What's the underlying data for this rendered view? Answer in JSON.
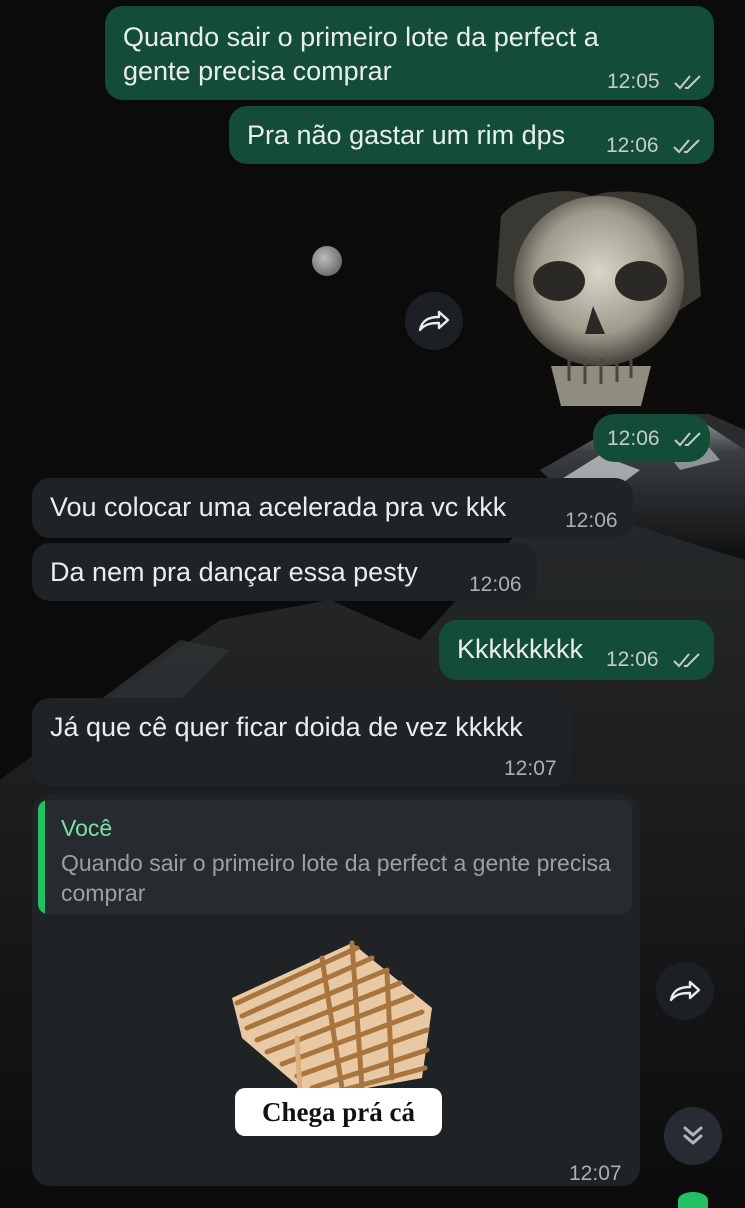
{
  "colors": {
    "outgoing_bubble": "#144d37",
    "incoming_bubble": "#1f2326",
    "read_ticks": "#c4cbd0",
    "quote_accent": "#21c063",
    "quote_author": "#7ddfa6"
  },
  "messages": [
    {
      "text": "Quando sair o primeiro lote da perfect a gente precisa comprar",
      "time": "12:05"
    },
    {
      "text": "Pra não gastar um rim dps",
      "time": "12:06"
    },
    {
      "time": "12:06",
      "icon": "skull-image"
    },
    {
      "text": "Vou colocar uma acelerada pra vc kkk",
      "time": "12:06"
    },
    {
      "text": "Da nem pra dançar essa pesty",
      "time": "12:06"
    },
    {
      "text": "Kkkkkkkkk",
      "time": "12:06"
    },
    {
      "text": "Já que cê quer ficar doida de vez kkkkk",
      "time": "12:07"
    },
    {
      "quote_author": "Você",
      "quote_text": "Quando sair o primeiro lote da perfect a gente precisa comprar",
      "sticker_caption": "Chega prá cá",
      "time": "12:07"
    }
  ],
  "icons": {
    "forward": "forward-arrow-icon",
    "scroll_down": "double-chevron-down-icon",
    "read_receipt": "double-check-icon"
  }
}
